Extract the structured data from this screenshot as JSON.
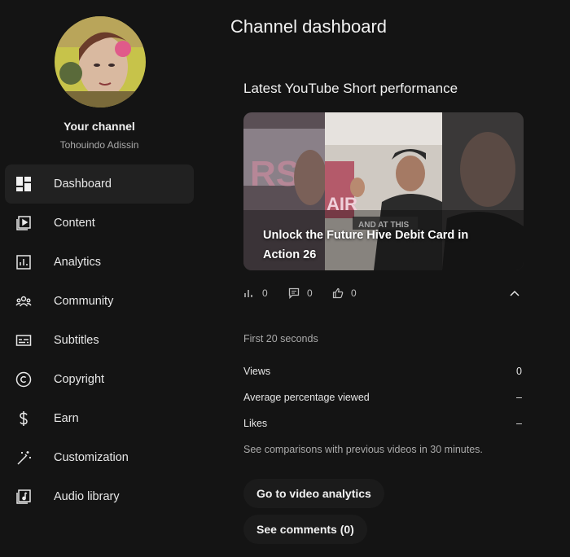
{
  "channel": {
    "label": "Your channel",
    "name": "Tohouindo Adissin"
  },
  "sidebar": {
    "items": [
      {
        "label": "Dashboard",
        "icon": "dashboard-icon",
        "active": true
      },
      {
        "label": "Content",
        "icon": "content-icon"
      },
      {
        "label": "Analytics",
        "icon": "analytics-icon"
      },
      {
        "label": "Community",
        "icon": "community-icon"
      },
      {
        "label": "Subtitles",
        "icon": "subtitles-icon"
      },
      {
        "label": "Copyright",
        "icon": "copyright-icon"
      },
      {
        "label": "Earn",
        "icon": "dollar-icon"
      },
      {
        "label": "Customization",
        "icon": "magic-wand-icon"
      },
      {
        "label": "Audio library",
        "icon": "audio-library-icon"
      }
    ]
  },
  "main": {
    "title": "Channel dashboard",
    "section_title": "Latest YouTube Short performance",
    "short": {
      "title": "Unlock the Future Hive Debit Card in Action 26",
      "overlay_caption": "AND AT THIS",
      "views": "0",
      "comments": "0",
      "likes": "0"
    },
    "period": "First 20 seconds",
    "metrics": [
      {
        "label": "Views",
        "value": "0"
      },
      {
        "label": "Average percentage viewed",
        "value": "–"
      },
      {
        "label": "Likes",
        "value": "–"
      }
    ],
    "note": "See comparisons with previous videos in 30 minutes.",
    "buttons": {
      "analytics": "Go to video analytics",
      "comments": "See comments (0)"
    }
  },
  "colors": {
    "background": "#141414",
    "active_item": "#212121",
    "text_primary": "#f1f1f1",
    "text_secondary": "#aaaaaa"
  }
}
